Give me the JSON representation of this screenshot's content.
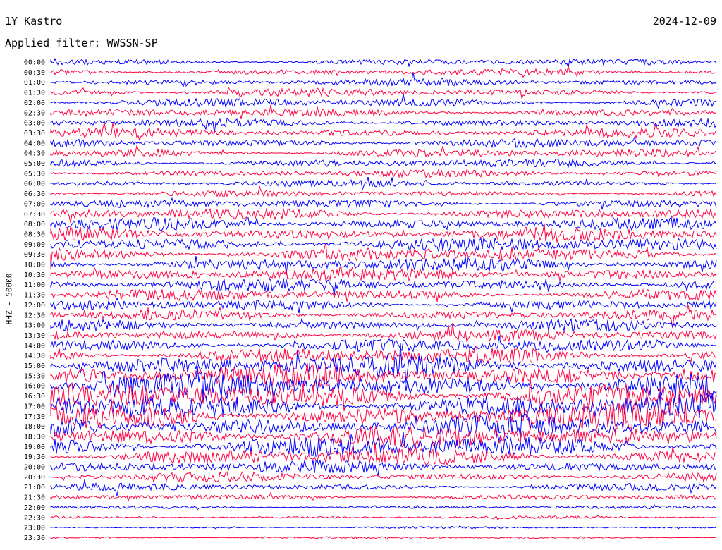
{
  "header": {
    "station": "1Y Kastro",
    "date": "2024-12-09",
    "filter_label": "Applied filter: WWSSN-SP"
  },
  "chart_data": {
    "type": "line",
    "plot_kind": "helicorder",
    "ylabel": "HHZ - 50000",
    "row_labels": [
      "00:00",
      "00:30",
      "01:00",
      "01:30",
      "02:00",
      "02:30",
      "03:00",
      "03:30",
      "04:00",
      "04:30",
      "05:00",
      "05:30",
      "06:00",
      "06:30",
      "07:00",
      "07:30",
      "08:00",
      "08:30",
      "09:00",
      "09:30",
      "10:00",
      "10:30",
      "11:00",
      "11:30",
      "12:00",
      "12:30",
      "13:00",
      "13:30",
      "14:00",
      "14:30",
      "15:00",
      "15:30",
      "16:00",
      "16:30",
      "17:00",
      "17:30",
      "18:00",
      "18:30",
      "19:00",
      "19:30",
      "20:00",
      "20:30",
      "21:00",
      "21:30",
      "22:00",
      "22:30",
      "23:00",
      "23:30"
    ],
    "row_interval_minutes": 30,
    "colors": [
      "#0000ff",
      "#ff0040"
    ],
    "relative_amplitude": [
      1.2,
      1.3,
      1.4,
      1.5,
      1.7,
      1.6,
      1.6,
      1.8,
      1.7,
      1.6,
      1.6,
      1.4,
      1.3,
      1.2,
      1.6,
      2.2,
      2.4,
      2.6,
      2.8,
      2.7,
      2.6,
      2.6,
      2.4,
      2.2,
      2.0,
      2.0,
      2.1,
      2.3,
      2.6,
      3.2,
      4.0,
      4.6,
      4.8,
      5.0,
      4.8,
      4.6,
      4.4,
      4.2,
      4.0,
      3.2,
      2.4,
      1.8,
      1.4,
      1.0,
      0.6,
      0.5,
      0.4,
      0.4
    ],
    "grid": false,
    "legend": "none"
  }
}
